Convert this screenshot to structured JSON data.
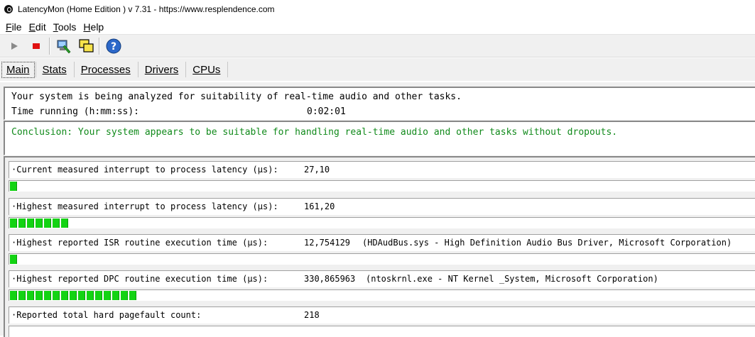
{
  "window": {
    "title": "LatencyMon  (Home Edition )  v 7.31 - https://www.resplendence.com"
  },
  "menu": {
    "items": [
      {
        "accel": "F",
        "rest": "ile"
      },
      {
        "accel": "E",
        "rest": "dit"
      },
      {
        "accel": "T",
        "rest": "ools"
      },
      {
        "accel": "H",
        "rest": "elp"
      }
    ]
  },
  "toolbar": {
    "icons": [
      "play-icon",
      "stop-icon",
      "computer-wrench-icon",
      "windows-icon",
      "help-icon"
    ]
  },
  "tabs": [
    {
      "label": "Main",
      "active": true
    },
    {
      "label": "Stats",
      "active": false
    },
    {
      "label": "Processes",
      "active": false
    },
    {
      "label": "Drivers",
      "active": false
    },
    {
      "label": "CPUs",
      "active": false
    }
  ],
  "status": {
    "analyzing": "Your system is being analyzed for suitability of real-time audio and other tasks.",
    "time_label": "Time running (h:mm:ss):",
    "time_value": "0:02:01",
    "conclusion": "Conclusion: Your system appears to be suitable for handling real-time audio and other tasks without dropouts.",
    "conclusion_color": "#118a1b"
  },
  "metrics": [
    {
      "label": "·Current measured interrupt to process latency (µs):",
      "value": "27,10",
      "extra": "",
      "bar_segments": 1
    },
    {
      "label": "·Highest measured interrupt to process latency (µs):",
      "value": "161,20",
      "extra": "",
      "bar_segments": 7
    },
    {
      "label": "·Highest reported ISR routine execution time (µs):",
      "value": "12,754129",
      "extra": "(HDAudBus.sys - High Definition Audio Bus Driver, Microsoft Corporation)",
      "bar_segments": 1
    },
    {
      "label": "·Highest reported DPC routine execution time (µs):",
      "value": "330,865963",
      "extra": "(ntoskrnl.exe - NT Kernel _System, Microsoft Corporation)",
      "bar_segments": 15
    },
    {
      "label": "·Reported total hard pagefault count:",
      "value": "218",
      "extra": "",
      "bar_segments": 0
    }
  ],
  "colors": {
    "bar_green": "#13d313",
    "bar_green_edge": "#0a9a0a"
  }
}
